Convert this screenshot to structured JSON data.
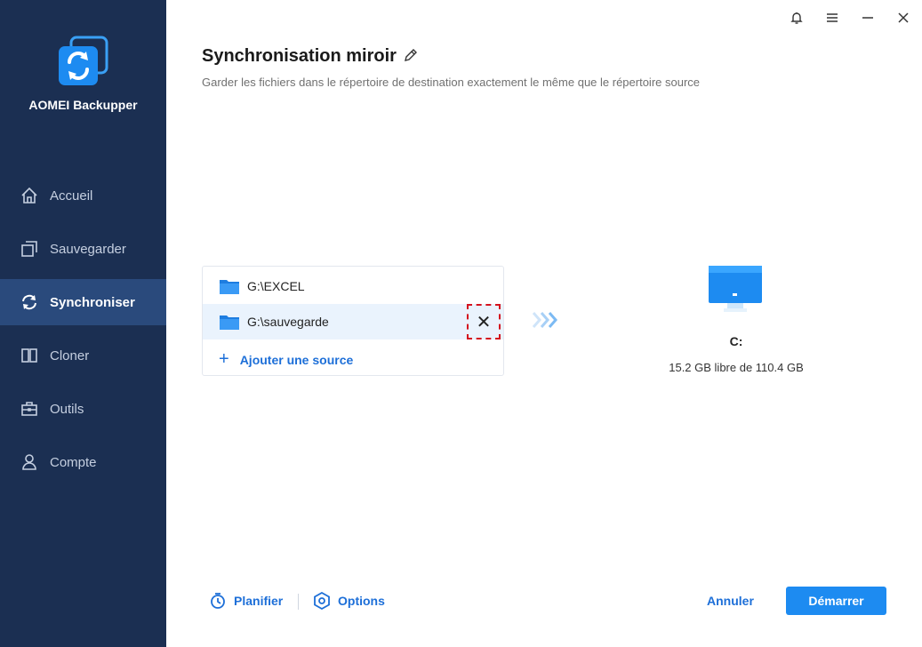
{
  "app": {
    "name": "AOMEI Backupper"
  },
  "sidebar": {
    "items": [
      {
        "label": "Accueil",
        "icon": "home-icon",
        "active": false
      },
      {
        "label": "Sauvegarder",
        "icon": "backup-icon",
        "active": false
      },
      {
        "label": "Synchroniser",
        "icon": "sync-icon",
        "active": true
      },
      {
        "label": "Cloner",
        "icon": "clone-icon",
        "active": false
      },
      {
        "label": "Outils",
        "icon": "toolbox-icon",
        "active": false
      },
      {
        "label": "Compte",
        "icon": "user-icon",
        "active": false
      }
    ]
  },
  "header": {
    "title": "Synchronisation miroir",
    "subtitle": "Garder les fichiers dans le répertoire de destination exactement le même que le répertoire source"
  },
  "sources": {
    "items": [
      {
        "path": "G:\\EXCEL"
      },
      {
        "path": "G:\\sauvegarde"
      }
    ],
    "remove_symbol": "✕",
    "add_label": "Ajouter une source"
  },
  "destination": {
    "drive": "C:",
    "free_space": "15.2 GB libre de 110.4 GB"
  },
  "footer": {
    "schedule_label": "Planifier",
    "options_label": "Options",
    "cancel_label": "Annuler",
    "start_label": "Démarrer"
  },
  "colors": {
    "sidebar_bg": "#1b2f52",
    "sidebar_active": "#2a4a7c",
    "accent": "#1d6fd8",
    "primary_button": "#1d8bf1",
    "highlight_border": "#d4121f"
  }
}
